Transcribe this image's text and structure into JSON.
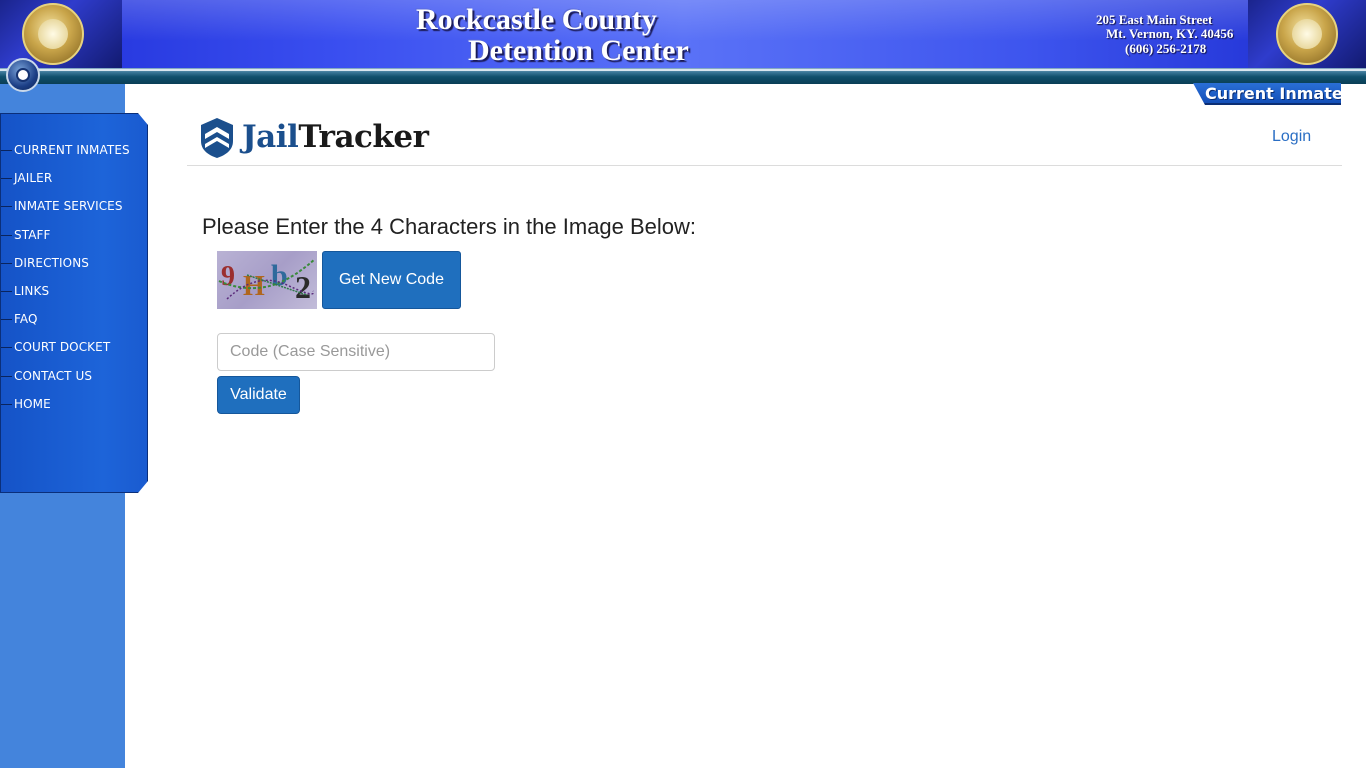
{
  "banner": {
    "title_line1": "Rockcastle County",
    "title_line2": "Detention Center",
    "address_line1": "205 East Main Street",
    "address_line2": "Mt. Vernon, KY. 40456",
    "address_line3": "(606) 256-2178"
  },
  "nav": {
    "items": [
      {
        "label": "CURRENT INMATES"
      },
      {
        "label": "JAILER"
      },
      {
        "label": "INMATE SERVICES"
      },
      {
        "label": "STAFF"
      },
      {
        "label": "DIRECTIONS"
      },
      {
        "label": "LINKS"
      },
      {
        "label": "FAQ"
      },
      {
        "label": "COURT DOCKET"
      },
      {
        "label": "CONTACT US"
      },
      {
        "label": "HOME"
      }
    ]
  },
  "section_tab": {
    "label": "Current Inmates"
  },
  "jailtracker": {
    "brand_part1": "Jail",
    "brand_part2": "Tracker",
    "login_label": "Login"
  },
  "captcha": {
    "prompt": "Please Enter the 4 Characters in the Image Below:",
    "characters": [
      "9",
      "H",
      "b",
      "2"
    ],
    "new_code_label": "Get New Code",
    "input_value": "",
    "input_placeholder": "Code (Case Sensitive)",
    "validate_label": "Validate"
  },
  "colors": {
    "banner_blue": "#3a4ff0",
    "nav_blue": "#1d64d9",
    "left_column": "#4484dc",
    "button_blue": "#1f6fbe",
    "link_blue": "#2a6ec4",
    "brand_blue": "#1b4f8d"
  }
}
